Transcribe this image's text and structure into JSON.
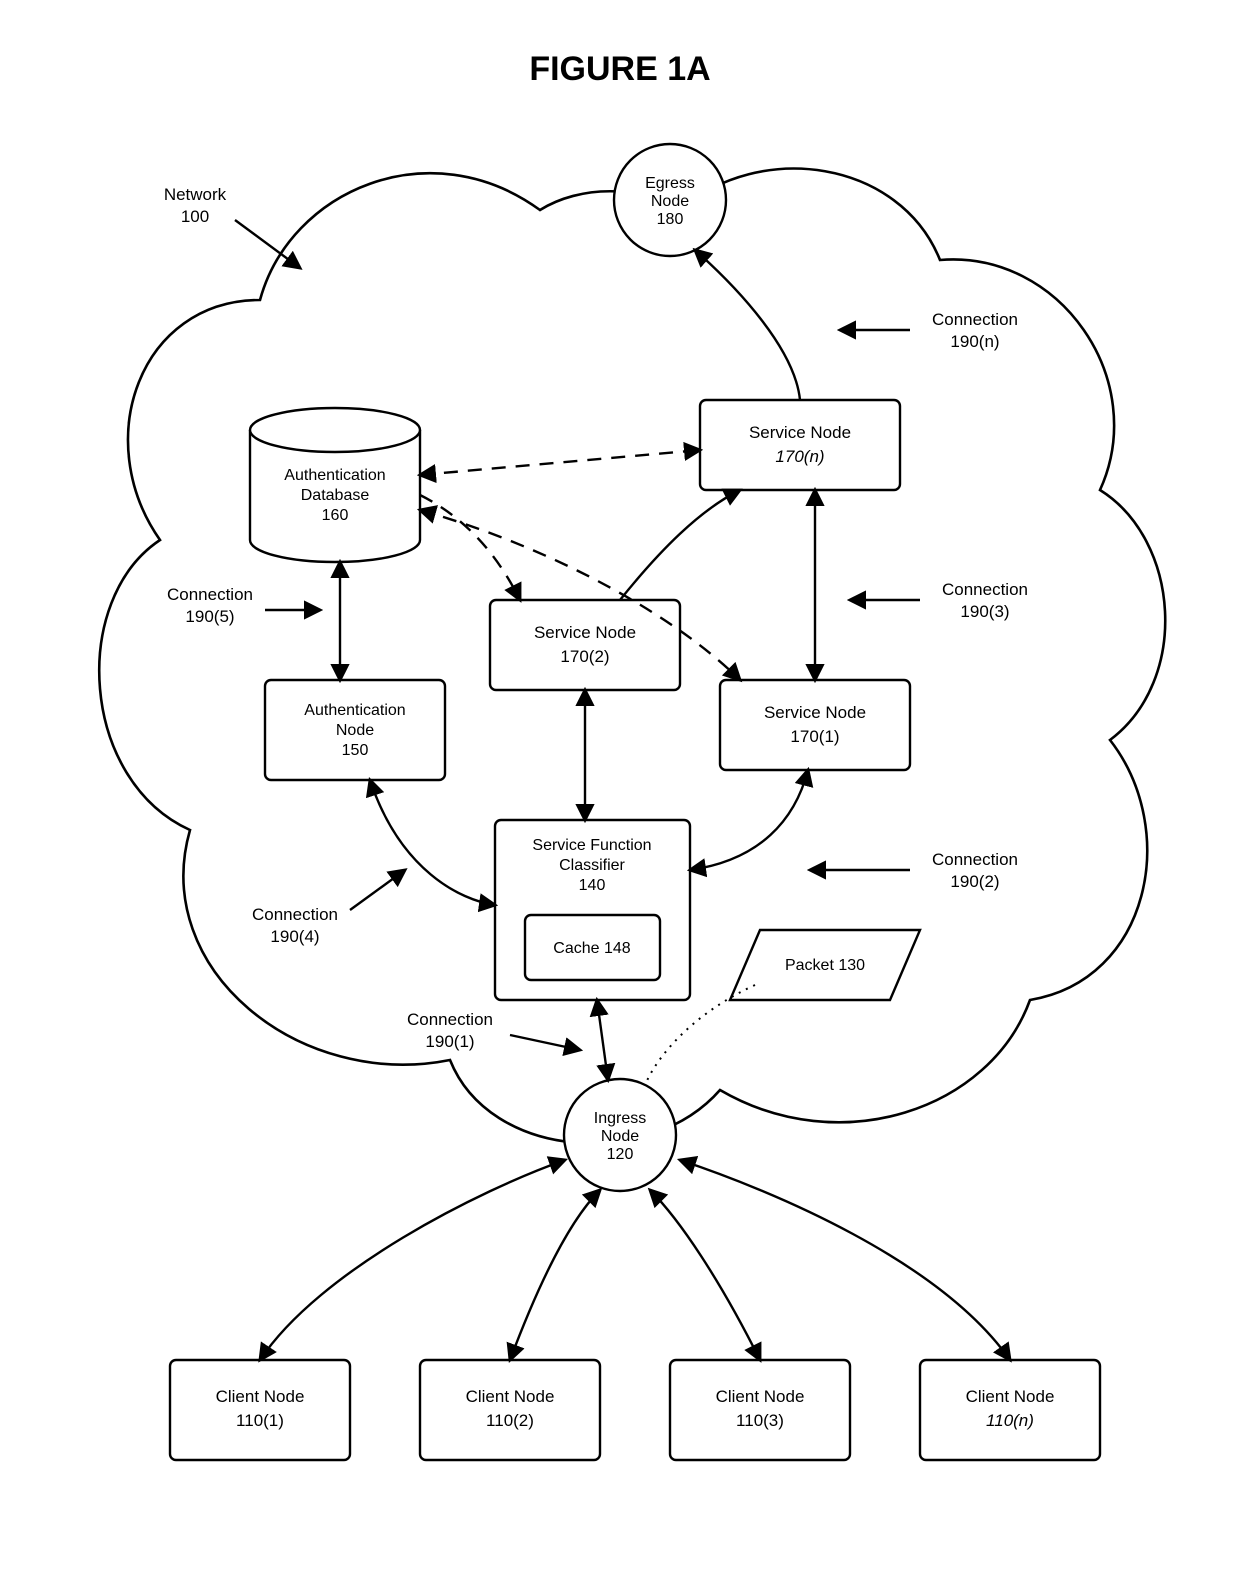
{
  "title": "FIGURE 1A",
  "network_label": {
    "l1": "Network",
    "l2": "100"
  },
  "nodes": {
    "egress": {
      "l1": "Egress",
      "l2": "Node",
      "l3": "180"
    },
    "ingress": {
      "l1": "Ingress",
      "l2": "Node",
      "l3": "120"
    },
    "authdb": {
      "l1": "Authentication",
      "l2": "Database",
      "l3": "160"
    },
    "authnode": {
      "l1": "Authentication",
      "l2": "Node",
      "l3": "150"
    },
    "svc1": {
      "l1": "Service Node",
      "l2": "170(1)"
    },
    "svc2": {
      "l1": "Service Node",
      "l2": "170(2)"
    },
    "svcn": {
      "l1": "Service Node",
      "l2": "170(n)"
    },
    "sfc": {
      "l1": "Service Function",
      "l2": "Classifier",
      "l3": "140"
    },
    "cache": {
      "l1": "Cache 148"
    },
    "packet": {
      "l1": "Packet 130"
    },
    "client1": {
      "l1": "Client Node",
      "l2": "110(1)"
    },
    "client2": {
      "l1": "Client Node",
      "l2": "110(2)"
    },
    "client3": {
      "l1": "Client Node",
      "l2": "110(3)"
    },
    "clientn": {
      "l1": "Client Node",
      "l2": "110(n)"
    }
  },
  "connections": {
    "c1": {
      "l1": "Connection",
      "l2": "190(1)"
    },
    "c2": {
      "l1": "Connection",
      "l2": "190(2)"
    },
    "c3": {
      "l1": "Connection",
      "l2": "190(3)"
    },
    "c4": {
      "l1": "Connection",
      "l2": "190(4)"
    },
    "c5": {
      "l1": "Connection",
      "l2": "190(5)"
    },
    "cn": {
      "l1": "Connection",
      "l2": "190(n)"
    }
  }
}
